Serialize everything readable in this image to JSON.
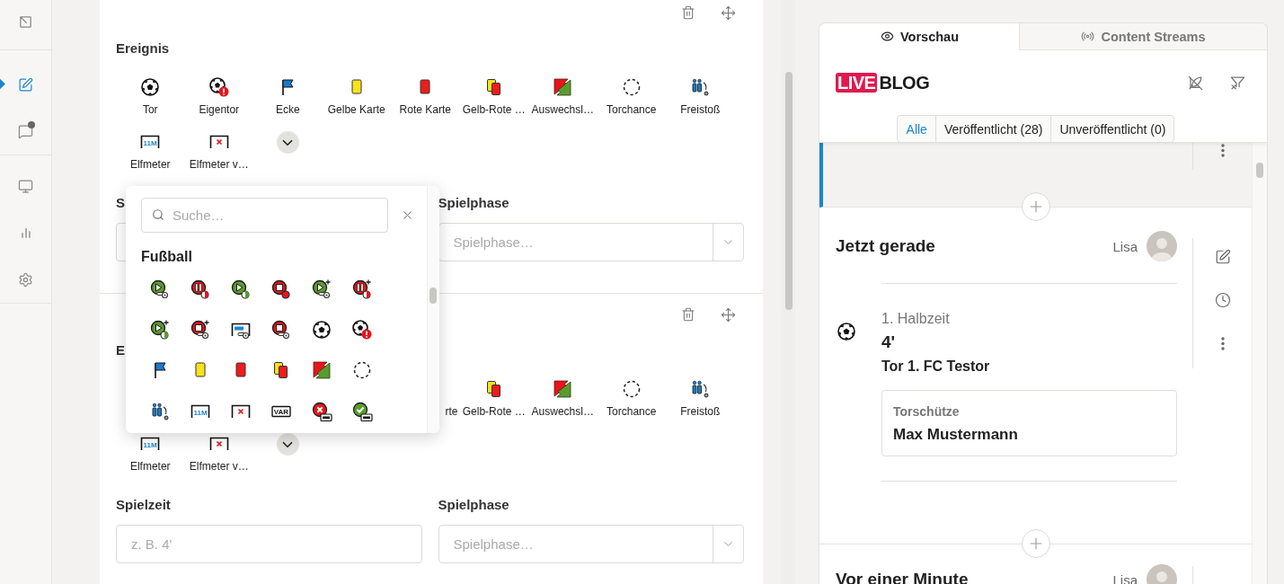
{
  "rail": {
    "groups": [
      {
        "items": [
          {
            "kind": "exit",
            "selected": false,
            "unread": false
          }
        ]
      },
      {
        "items": [
          {
            "kind": "edit",
            "selected": true,
            "unread": false
          },
          {
            "kind": "chat",
            "selected": false,
            "unread": true
          }
        ]
      },
      {
        "items": [
          {
            "kind": "monitor",
            "selected": false,
            "unread": false
          },
          {
            "kind": "chart",
            "selected": false,
            "unread": false
          },
          {
            "kind": "settings",
            "selected": false,
            "unread": false
          }
        ]
      }
    ]
  },
  "event_blocks": [
    {
      "label": "Ereignis",
      "rows": [
        [
          {
            "kind": "ball",
            "label": "Tor"
          },
          {
            "kind": "ball-alert",
            "label": "Eigentor"
          },
          {
            "kind": "flag",
            "label": "Ecke"
          },
          {
            "kind": "yellow-card",
            "label": "Gelbe Karte"
          },
          {
            "kind": "red-card",
            "label": "Rote Karte"
          },
          {
            "kind": "yellow-red-card",
            "label": "Gelb-Rote …"
          },
          {
            "kind": "substitution",
            "label": "Auswechsl…"
          },
          {
            "kind": "chance",
            "label": "Torchance"
          },
          {
            "kind": "free-kick",
            "label": "Freistoß"
          }
        ],
        [
          {
            "kind": "penalty",
            "label": "Elfmeter",
            "icon_text": "11M"
          },
          {
            "kind": "penalty-miss",
            "label": "Elfmeter v…"
          }
        ]
      ],
      "time_label": "S",
      "phase_label": "Spielphase",
      "phase_placeholder": "Spielphase…"
    },
    {
      "label": "E",
      "rows": [
        [
          {
            "kind": "partial",
            "label": "rte"
          },
          {
            "kind": "yellow-red-card",
            "label": "Gelb-Rote …"
          },
          {
            "kind": "substitution",
            "label": "Auswechsl…"
          },
          {
            "kind": "chance",
            "label": "Torchance"
          },
          {
            "kind": "free-kick",
            "label": "Freistoß"
          }
        ],
        [
          {
            "kind": "penalty",
            "label": "Elfmeter",
            "icon_text": "11M"
          },
          {
            "kind": "penalty-miss",
            "label": "Elfmeter v…"
          }
        ]
      ],
      "time_label": "Spielzeit",
      "time_placeholder": "z. B. 4'",
      "phase_label": "Spielphase",
      "phase_placeholder": "Spielphase…"
    }
  ],
  "picker": {
    "placeholder": "Suche…",
    "category": "Fußball",
    "icons": [
      {
        "kind": "play-whistle"
      },
      {
        "kind": "pause-watch"
      },
      {
        "kind": "play-watch"
      },
      {
        "kind": "stop-dot"
      },
      {
        "kind": "play-plus-whistle"
      },
      {
        "kind": "pause-plus-watch"
      },
      {
        "kind": "play-plus-watch"
      },
      {
        "kind": "stop-plus-whistle"
      },
      {
        "kind": "penalty-whistle"
      },
      {
        "kind": "stop-whistle"
      },
      {
        "kind": "ball"
      },
      {
        "kind": "ball-alert"
      },
      {
        "kind": "flag"
      },
      {
        "kind": "yellow-card"
      },
      {
        "kind": "red-card"
      },
      {
        "kind": "yellow-red-card"
      },
      {
        "kind": "substitution"
      },
      {
        "kind": "chance"
      },
      {
        "kind": "free-kick"
      },
      {
        "kind": "penalty",
        "icon_text": "11M"
      },
      {
        "kind": "penalty-miss"
      },
      {
        "kind": "var",
        "icon_text": "VAR"
      },
      {
        "kind": "var-miss"
      },
      {
        "kind": "var-ok"
      }
    ]
  },
  "preview": {
    "tabs": [
      {
        "kind": "eye",
        "label": "Vorschau",
        "selected": true
      },
      {
        "kind": "broadcast",
        "label": "Content Streams",
        "selected": false
      }
    ],
    "logo": {
      "badge": "LIVE",
      "text": "BLOG"
    },
    "filters": [
      {
        "label": "Alle",
        "selected": true
      },
      {
        "label": "Veröffentlicht (28)",
        "selected": false
      },
      {
        "label": "Unveröffentlicht (0)",
        "selected": false
      }
    ],
    "entries": [
      {
        "kind": "partial",
        "selected": true
      },
      {
        "kind": "event",
        "selected": false,
        "time": "Jetzt gerade",
        "author": "Lisa",
        "phase": "1. Halbzeit",
        "minute": "4'",
        "headline": "Tor 1. FC Testor",
        "detail_label": "Torschütze",
        "detail_value": "Max Mustermann"
      },
      {
        "kind": "heading",
        "selected": false,
        "time": "Vor einer Minute",
        "author": "Lisa"
      }
    ]
  }
}
